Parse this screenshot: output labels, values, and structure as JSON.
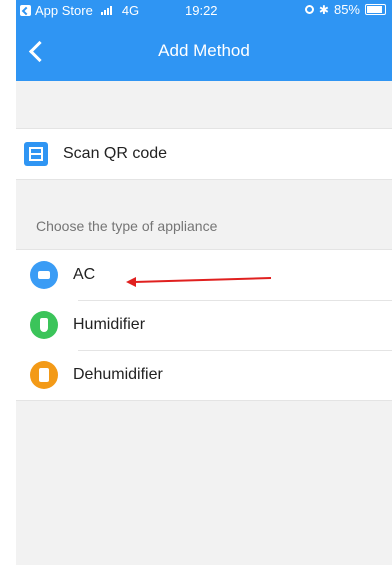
{
  "statusbar": {
    "carrier_back": "App Store",
    "network": "4G",
    "time": "19:22",
    "battery": "85%"
  },
  "navbar": {
    "title": "Add Method"
  },
  "scan": {
    "label": "Scan QR code"
  },
  "appliances": {
    "header": "Choose the type of appliance",
    "items": [
      {
        "label": "AC",
        "color": "#3a9cf5",
        "icon": "ac-icon"
      },
      {
        "label": "Humidifier",
        "color": "#3bc45a",
        "icon": "humidifier-icon"
      },
      {
        "label": "Dehumidifier",
        "color": "#f39a17",
        "icon": "dehumidifier-icon"
      }
    ]
  },
  "annotation": {
    "arrow_color": "#e0201f"
  }
}
